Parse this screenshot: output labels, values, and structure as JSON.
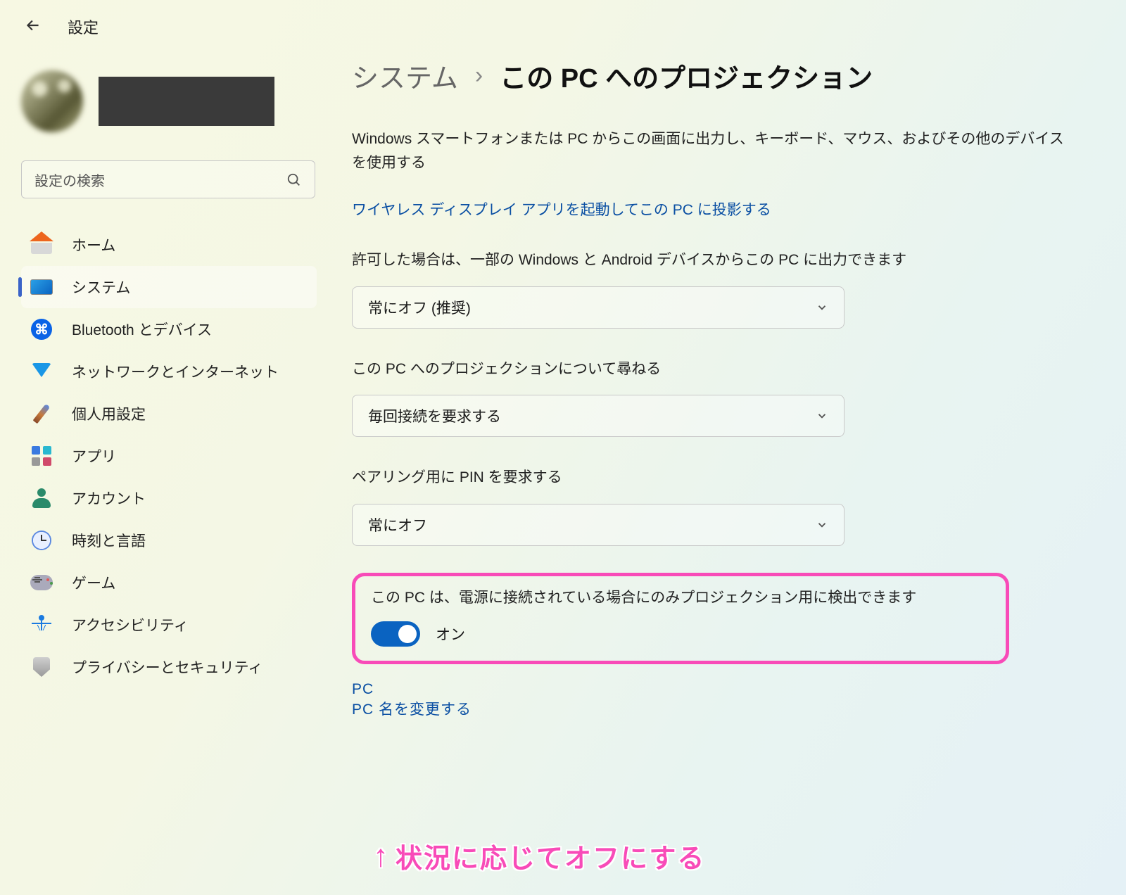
{
  "header": {
    "title": "設定"
  },
  "search": {
    "placeholder": "設定の検索"
  },
  "nav": [
    {
      "label": "ホーム",
      "icon": "home"
    },
    {
      "label": "システム",
      "icon": "system",
      "selected": true
    },
    {
      "label": "Bluetooth とデバイス",
      "icon": "bt"
    },
    {
      "label": "ネットワークとインターネット",
      "icon": "net"
    },
    {
      "label": "個人用設定",
      "icon": "pers"
    },
    {
      "label": "アプリ",
      "icon": "app"
    },
    {
      "label": "アカウント",
      "icon": "acct"
    },
    {
      "label": "時刻と言語",
      "icon": "time"
    },
    {
      "label": "ゲーム",
      "icon": "game"
    },
    {
      "label": "アクセシビリティ",
      "icon": "acc"
    },
    {
      "label": "プライバシーとセキュリティ",
      "icon": "priv"
    }
  ],
  "breadcrumb": {
    "parent": "システム",
    "current": "この PC へのプロジェクション"
  },
  "page": {
    "description": "Windows スマートフォンまたは PC からこの画面に出力し、キーボード、マウス、およびその他のデバイスを使用する",
    "link": "ワイヤレス ディスプレイ アプリを起動してこの PC に投影する",
    "group1": {
      "label": "許可した場合は、一部の Windows と Android デバイスからこの PC に出力できます",
      "value": "常にオフ (推奨)"
    },
    "group2": {
      "label": "この PC へのプロジェクションについて尋ねる",
      "value": "毎回接続を要求する"
    },
    "group3": {
      "label": "ペアリング用に PIN を要求する",
      "value": "常にオフ"
    },
    "group4": {
      "label": "この PC は、電源に接続されている場合にのみプロジェクション用に検出できます",
      "toggle_state": "on",
      "toggle_label": "オン"
    },
    "footer": {
      "line1": "PC",
      "line2": "PC 名を変更する"
    }
  },
  "annotation": {
    "arrow": "↑",
    "text": "状況に応じてオフにする"
  }
}
